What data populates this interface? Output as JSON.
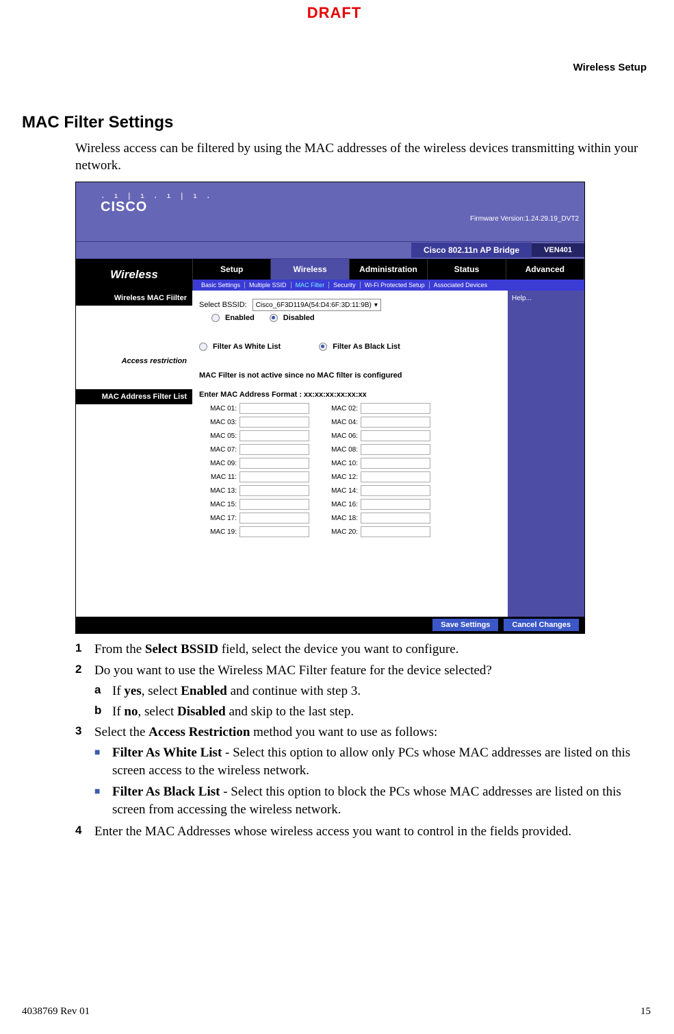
{
  "page": {
    "draft": "DRAFT",
    "header_right": "Wireless Setup",
    "title": "MAC Filter Settings",
    "intro": "Wireless access can be filtered by using the MAC addresses of the wireless devices transmitting within your network.",
    "footer_left": "4038769 Rev 01",
    "footer_right": "15"
  },
  "ss": {
    "logo_bars": ". ı | ı . ı | ı .",
    "logo_text": "CISCO",
    "firmware": "Firmware Version:1.24.29.19_DVT2",
    "product": "Cisco 802.11n AP Bridge",
    "model": "VEN401",
    "nav_title": "Wireless",
    "tabs": [
      "Setup",
      "Wireless",
      "Administration",
      "Status",
      "Advanced"
    ],
    "subtabs": [
      "Basic Settings",
      "Multiple SSID",
      "MAC Filter",
      "Security",
      "Wi-Fi Protected Setup",
      "Associated Devices"
    ],
    "help": "Help...",
    "left_rows": [
      "Wireless MAC Fiilter",
      "Access restriction",
      "MAC Address Filter List"
    ],
    "select_bssid_lbl": "Select BSSID:",
    "select_bssid_val": "Cisco_6F3D119A(54:D4:6F:3D:11:9B)",
    "enabled": "Enabled",
    "disabled": "Disabled",
    "white": "Filter As White List",
    "black": "Filter As Black List",
    "warn": "MAC Filter is not active since no MAC filter is configured",
    "enter_fmt": "Enter MAC Address Format : xx:xx:xx:xx:xx:xx",
    "mac_rows": [
      [
        "MAC 01:",
        "MAC 02:"
      ],
      [
        "MAC 03:",
        "MAC 04:"
      ],
      [
        "MAC 05:",
        "MAC 06:"
      ],
      [
        "MAC 07:",
        "MAC 08:"
      ],
      [
        "MAC 09:",
        "MAC 10:"
      ],
      [
        "MAC 11:",
        "MAC 12:"
      ],
      [
        "MAC 13:",
        "MAC 14:"
      ],
      [
        "MAC 15:",
        "MAC 16:"
      ],
      [
        "MAC 17:",
        "MAC 18:"
      ],
      [
        "MAC 19:",
        "MAC 20:"
      ]
    ],
    "save": "Save Settings",
    "cancel": "Cancel Changes"
  },
  "instr": {
    "s1_a": "From the ",
    "s1_b": "Select BSSID",
    "s1_c": " field, select the device you want to configure.",
    "s2": "Do you want to use the Wireless MAC Filter feature for the device selected?",
    "s2a_a": "If ",
    "s2a_b": "yes",
    "s2a_c": ", select ",
    "s2a_d": "Enabled",
    "s2a_e": " and continue with step 3.",
    "s2b_a": "If ",
    "s2b_b": "no",
    "s2b_c": ", select ",
    "s2b_d": "Disabled",
    "s2b_e": " and skip to the last step.",
    "s3_a": "Select the ",
    "s3_b": "Access Restriction",
    "s3_c": " method you want to use as follows:",
    "s3w_a": "Filter As White List",
    "s3w_b": " - Select this option to allow only PCs whose MAC addresses are listed on this screen access to the wireless network.",
    "s3b_a": "Filter As Black List",
    "s3b_b": " - Select this option to block the PCs whose MAC addresses are listed on this screen from accessing the wireless network.",
    "s4": "Enter the MAC Addresses whose wireless access you want to control in the fields provided.",
    "n1": "1",
    "n2": "2",
    "n3": "3",
    "n4": "4",
    "la": "a",
    "lb": "b",
    "bullet": "■"
  }
}
